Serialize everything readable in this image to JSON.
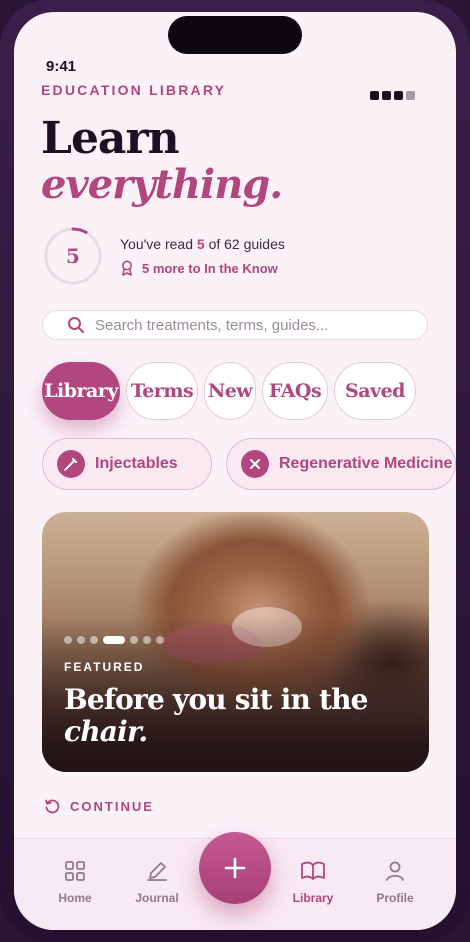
{
  "status": {
    "time": "9:41"
  },
  "header": {
    "eyebrow": "EDUCATION LIBRARY",
    "title_line1": "Learn",
    "title_line2": "everything."
  },
  "progress": {
    "count": "5",
    "read_prefix": "You've read ",
    "read_count": "5",
    "read_suffix": " of 62 guides",
    "fraction_read": 0.08,
    "milestone": "5 more to In the Know"
  },
  "search": {
    "placeholder": "Search treatments, terms, guides..."
  },
  "tabs": [
    {
      "label": "Library",
      "active": true
    },
    {
      "label": "Terms",
      "active": false
    },
    {
      "label": "New",
      "active": false
    },
    {
      "label": "FAQs",
      "active": false
    },
    {
      "label": "Saved",
      "active": false
    }
  ],
  "chips": [
    {
      "label": "Injectables",
      "icon": "syringe-icon"
    },
    {
      "label": "Regenerative Medicine",
      "icon": "close-x-icon"
    }
  ],
  "feature": {
    "tag": "FEATURED",
    "title_regular": "Before you sit in the",
    "title_italic": "chair.",
    "slides_total": 7,
    "slide_active": 3
  },
  "continue": {
    "label": "CONTINUE"
  },
  "nav": {
    "home": "Home",
    "journal": "Journal",
    "library": "Library",
    "profile": "Profile"
  },
  "colors": {
    "accent": "#b2467f",
    "background": "#fbf2f8",
    "ink": "#1c1024"
  }
}
